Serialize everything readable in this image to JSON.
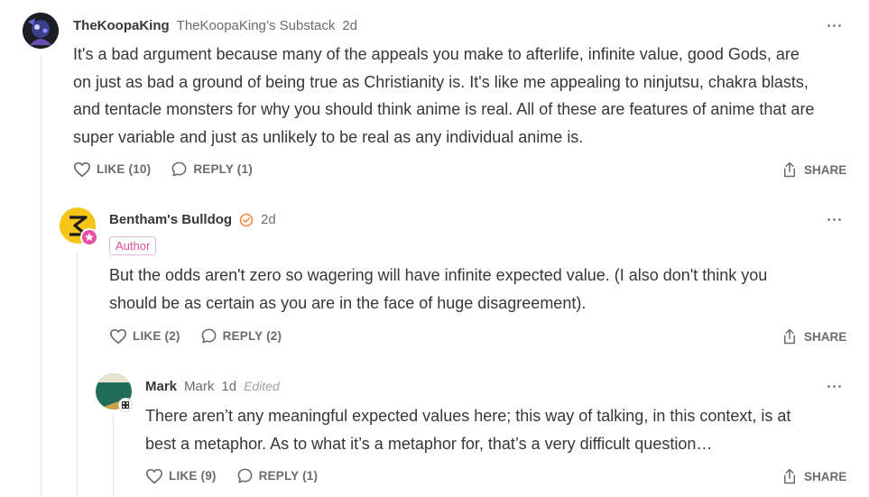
{
  "comments": [
    {
      "author": "TheKoopaKing",
      "publication": "TheKoopaKing’s Substack",
      "time": "2d",
      "body_lines": [
        "It's a bad argument because many of the appeals you make to afterlife, infinite value, good Gods, are",
        "on just as bad a ground of being true as Christianity is. It's like me appealing to ninjutsu, chakra blasts,",
        "and tentacle monsters for why you should think anime is real. All of these are features of anime that are",
        "super variable and just as unlikely to be real as any individual anime is."
      ],
      "like_label": "LIKE (10)",
      "reply_label": "REPLY (1)",
      "share_label": "SHARE"
    },
    {
      "author": "Bentham's Bulldog",
      "time": "2d",
      "badge": "Author",
      "body_lines": [
        "But the odds aren't zero so wagering will have infinite expected value. (I also don't think you",
        "should be as certain as you are in the face of huge disagreement)."
      ],
      "like_label": "LIKE (2)",
      "reply_label": "REPLY (2)",
      "share_label": "SHARE"
    },
    {
      "author": "Mark",
      "publication": "Mark",
      "time": "1d",
      "edited": "Edited",
      "body_lines": [
        "There aren’t any meaningful expected values here; this way of talking, in this context, is at",
        "best a metaphor. As to what it’s a metaphor for, that’s a very difficult question…"
      ],
      "like_label": "LIKE (9)",
      "reply_label": "REPLY (1)",
      "share_label": "SHARE"
    }
  ],
  "colors": {
    "bulldog_avatar": "#f5c518",
    "author_badge": "#d94ea0",
    "verified": "#f08a3c",
    "mark_avatar": "#1f6d57"
  },
  "icons": [
    "more-icon",
    "heart-icon",
    "reply-icon",
    "share-icon",
    "verified-check-icon"
  ]
}
